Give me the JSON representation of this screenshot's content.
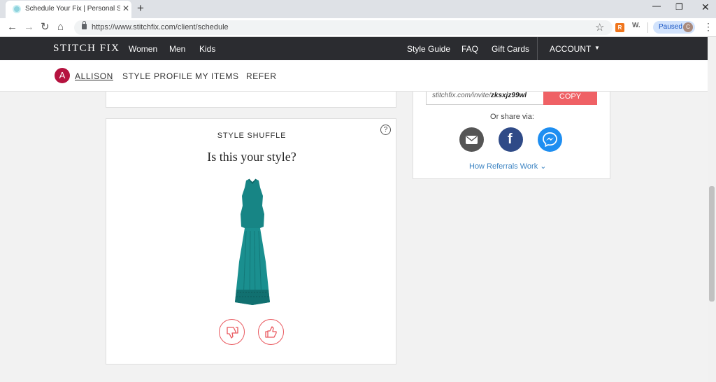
{
  "browser": {
    "tab_title": "Schedule Your Fix | Personal Stylist",
    "close_glyph": "✕",
    "new_tab_glyph": "+",
    "url": "https://www.stitchfix.com/client/schedule",
    "extension_w_label": "W.",
    "profile_status": "Paused",
    "profile_initial": "C"
  },
  "header": {
    "logo": "STITCH FIX",
    "nav": {
      "women": "Women",
      "men": "Men",
      "kids": "Kids"
    },
    "right_nav": {
      "style_guide": "Style Guide",
      "faq": "FAQ",
      "gift_cards": "Gift Cards",
      "account": "ACCOUNT"
    }
  },
  "subnav": {
    "avatar_initial": "A",
    "user_name": "ALLISON",
    "style_profile": "STYLE PROFILE",
    "my_items": "MY ITEMS",
    "refer": "REFER"
  },
  "style_shuffle": {
    "title": "STYLE SHUFFLE",
    "question": "Is this your style?",
    "help_glyph": "?",
    "item_color": "#1a8c8c"
  },
  "referral": {
    "invite_prefix": "stitchfix.com/invite/",
    "invite_code": "zksxjz99wl",
    "copy_label": "COPY",
    "share_label": "Or share via:",
    "how_link": "How Referrals Work",
    "link_arrow": "⌄"
  },
  "colors": {
    "header_bg": "#2b2c30",
    "accent": "#e9585e",
    "avatar": "#b5123f",
    "facebook": "#2f4a87",
    "messenger": "#1e8ef1",
    "link": "#3b83c2"
  }
}
